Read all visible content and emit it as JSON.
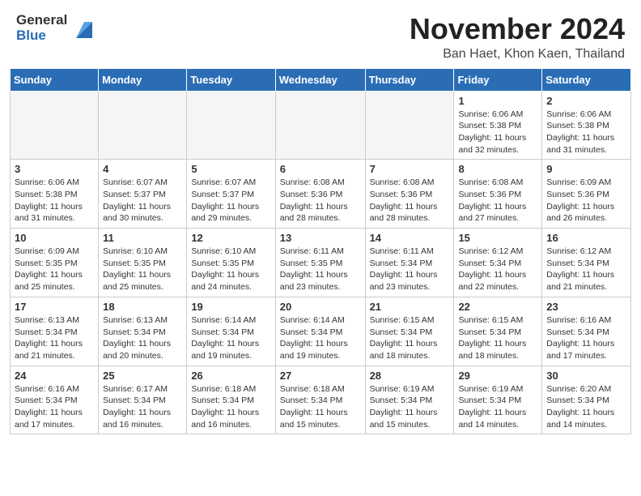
{
  "header": {
    "logo_line1": "General",
    "logo_line2": "Blue",
    "title": "November 2024",
    "subtitle": "Ban Haet, Khon Kaen, Thailand"
  },
  "weekdays": [
    "Sunday",
    "Monday",
    "Tuesday",
    "Wednesday",
    "Thursday",
    "Friday",
    "Saturday"
  ],
  "weeks": [
    [
      {
        "num": "",
        "info": "",
        "empty": true
      },
      {
        "num": "",
        "info": "",
        "empty": true
      },
      {
        "num": "",
        "info": "",
        "empty": true
      },
      {
        "num": "",
        "info": "",
        "empty": true
      },
      {
        "num": "",
        "info": "",
        "empty": true
      },
      {
        "num": "1",
        "info": "Sunrise: 6:06 AM\nSunset: 5:38 PM\nDaylight: 11 hours and 32 minutes.",
        "empty": false
      },
      {
        "num": "2",
        "info": "Sunrise: 6:06 AM\nSunset: 5:38 PM\nDaylight: 11 hours and 31 minutes.",
        "empty": false
      }
    ],
    [
      {
        "num": "3",
        "info": "Sunrise: 6:06 AM\nSunset: 5:38 PM\nDaylight: 11 hours and 31 minutes.",
        "empty": false
      },
      {
        "num": "4",
        "info": "Sunrise: 6:07 AM\nSunset: 5:37 PM\nDaylight: 11 hours and 30 minutes.",
        "empty": false
      },
      {
        "num": "5",
        "info": "Sunrise: 6:07 AM\nSunset: 5:37 PM\nDaylight: 11 hours and 29 minutes.",
        "empty": false
      },
      {
        "num": "6",
        "info": "Sunrise: 6:08 AM\nSunset: 5:36 PM\nDaylight: 11 hours and 28 minutes.",
        "empty": false
      },
      {
        "num": "7",
        "info": "Sunrise: 6:08 AM\nSunset: 5:36 PM\nDaylight: 11 hours and 28 minutes.",
        "empty": false
      },
      {
        "num": "8",
        "info": "Sunrise: 6:08 AM\nSunset: 5:36 PM\nDaylight: 11 hours and 27 minutes.",
        "empty": false
      },
      {
        "num": "9",
        "info": "Sunrise: 6:09 AM\nSunset: 5:36 PM\nDaylight: 11 hours and 26 minutes.",
        "empty": false
      }
    ],
    [
      {
        "num": "10",
        "info": "Sunrise: 6:09 AM\nSunset: 5:35 PM\nDaylight: 11 hours and 25 minutes.",
        "empty": false
      },
      {
        "num": "11",
        "info": "Sunrise: 6:10 AM\nSunset: 5:35 PM\nDaylight: 11 hours and 25 minutes.",
        "empty": false
      },
      {
        "num": "12",
        "info": "Sunrise: 6:10 AM\nSunset: 5:35 PM\nDaylight: 11 hours and 24 minutes.",
        "empty": false
      },
      {
        "num": "13",
        "info": "Sunrise: 6:11 AM\nSunset: 5:35 PM\nDaylight: 11 hours and 23 minutes.",
        "empty": false
      },
      {
        "num": "14",
        "info": "Sunrise: 6:11 AM\nSunset: 5:34 PM\nDaylight: 11 hours and 23 minutes.",
        "empty": false
      },
      {
        "num": "15",
        "info": "Sunrise: 6:12 AM\nSunset: 5:34 PM\nDaylight: 11 hours and 22 minutes.",
        "empty": false
      },
      {
        "num": "16",
        "info": "Sunrise: 6:12 AM\nSunset: 5:34 PM\nDaylight: 11 hours and 21 minutes.",
        "empty": false
      }
    ],
    [
      {
        "num": "17",
        "info": "Sunrise: 6:13 AM\nSunset: 5:34 PM\nDaylight: 11 hours and 21 minutes.",
        "empty": false
      },
      {
        "num": "18",
        "info": "Sunrise: 6:13 AM\nSunset: 5:34 PM\nDaylight: 11 hours and 20 minutes.",
        "empty": false
      },
      {
        "num": "19",
        "info": "Sunrise: 6:14 AM\nSunset: 5:34 PM\nDaylight: 11 hours and 19 minutes.",
        "empty": false
      },
      {
        "num": "20",
        "info": "Sunrise: 6:14 AM\nSunset: 5:34 PM\nDaylight: 11 hours and 19 minutes.",
        "empty": false
      },
      {
        "num": "21",
        "info": "Sunrise: 6:15 AM\nSunset: 5:34 PM\nDaylight: 11 hours and 18 minutes.",
        "empty": false
      },
      {
        "num": "22",
        "info": "Sunrise: 6:15 AM\nSunset: 5:34 PM\nDaylight: 11 hours and 18 minutes.",
        "empty": false
      },
      {
        "num": "23",
        "info": "Sunrise: 6:16 AM\nSunset: 5:34 PM\nDaylight: 11 hours and 17 minutes.",
        "empty": false
      }
    ],
    [
      {
        "num": "24",
        "info": "Sunrise: 6:16 AM\nSunset: 5:34 PM\nDaylight: 11 hours and 17 minutes.",
        "empty": false
      },
      {
        "num": "25",
        "info": "Sunrise: 6:17 AM\nSunset: 5:34 PM\nDaylight: 11 hours and 16 minutes.",
        "empty": false
      },
      {
        "num": "26",
        "info": "Sunrise: 6:18 AM\nSunset: 5:34 PM\nDaylight: 11 hours and 16 minutes.",
        "empty": false
      },
      {
        "num": "27",
        "info": "Sunrise: 6:18 AM\nSunset: 5:34 PM\nDaylight: 11 hours and 15 minutes.",
        "empty": false
      },
      {
        "num": "28",
        "info": "Sunrise: 6:19 AM\nSunset: 5:34 PM\nDaylight: 11 hours and 15 minutes.",
        "empty": false
      },
      {
        "num": "29",
        "info": "Sunrise: 6:19 AM\nSunset: 5:34 PM\nDaylight: 11 hours and 14 minutes.",
        "empty": false
      },
      {
        "num": "30",
        "info": "Sunrise: 6:20 AM\nSunset: 5:34 PM\nDaylight: 11 hours and 14 minutes.",
        "empty": false
      }
    ]
  ]
}
